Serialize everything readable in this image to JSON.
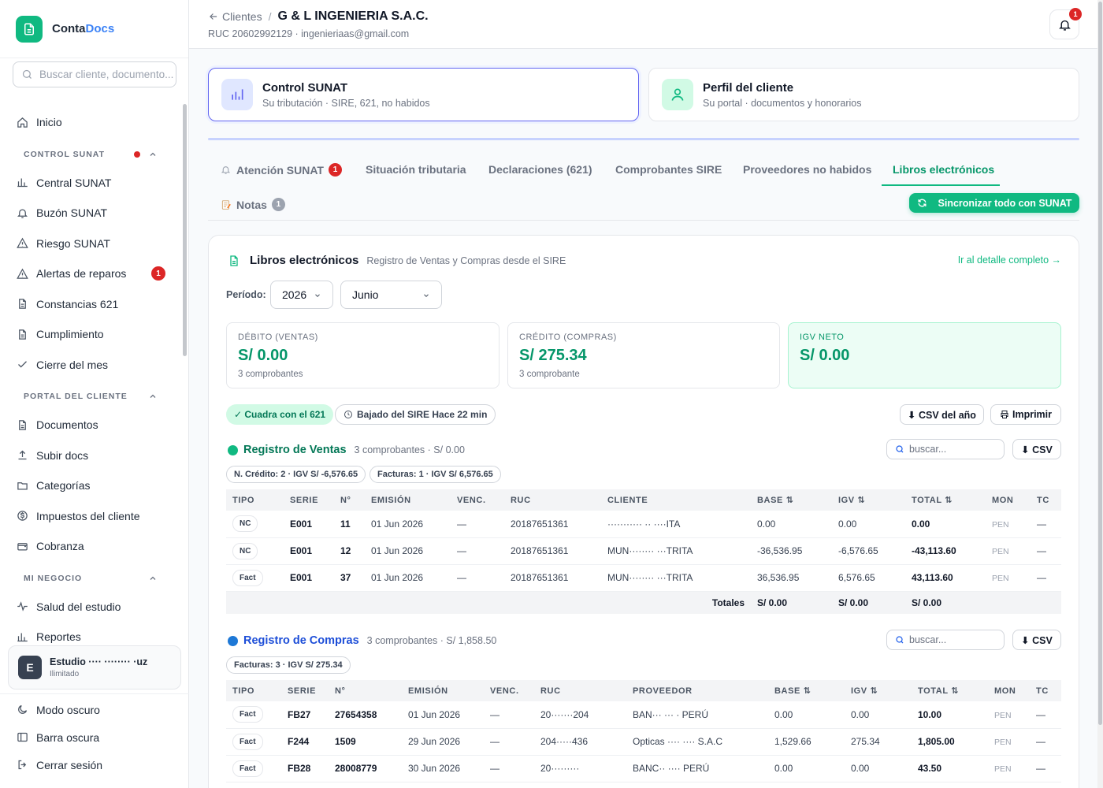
{
  "brand": {
    "name_a": "Conta",
    "name_b": "Docs"
  },
  "search": {
    "placeholder": "Buscar cliente, documento..."
  },
  "nav": {
    "inicio": "Inicio",
    "sec_control": "CONTROL SUNAT",
    "central": "Central SUNAT",
    "buzon": "Buzón SUNAT",
    "riesgo": "Riesgo SUNAT",
    "alertas": "Alertas de reparos",
    "alertas_badge": "1",
    "constancias": "Constancias 621",
    "cumplimiento": "Cumplimiento",
    "cierre": "Cierre del mes",
    "sec_portal": "PORTAL DEL CLIENTE",
    "documentos": "Documentos",
    "subir": "Subir docs",
    "categorias": "Categorías",
    "impuestos": "Impuestos del cliente",
    "cobranza": "Cobranza",
    "sec_negocio": "MI NEGOCIO",
    "salud": "Salud del estudio",
    "reportes": "Reportes"
  },
  "user": {
    "initial": "E",
    "name": "Estudio ···· ········ ·uz",
    "plan": "Ilimitado"
  },
  "bottom": {
    "dark_mode": "Modo oscuro",
    "dark_bar": "Barra oscura",
    "logout": "Cerrar sesión"
  },
  "header": {
    "back": "Clientes",
    "separator": "/",
    "client": "G & L INGENIERIA S.A.C.",
    "ruc_line": "RUC 20602992129 · ingenieriaas@gmail.com",
    "notif_count": "1"
  },
  "modes": [
    {
      "title": "Control SUNAT",
      "sub": "Su tributación · SIRE, 621, no habidos"
    },
    {
      "title": "Perfil del cliente",
      "sub": "Su portal · documentos y honorarios"
    }
  ],
  "tabs": {
    "atencion": "Atención SUNAT",
    "atencion_badge": "1",
    "situacion": "Situación tributaria",
    "declaraciones": "Declaraciones (621)",
    "comprobantes": "Comprobantes SIRE",
    "proveedores": "Proveedores no habidos",
    "libros": "Libros electrónicos",
    "notas": "Notas",
    "notas_badge": "1",
    "sync": "Sincronizar todo con SUNAT"
  },
  "panel": {
    "title": "Libros electrónicos",
    "subtitle": "Registro de Ventas y Compras desde el SIRE",
    "detail_link": "Ir al detalle completo →",
    "period_label": "Período:",
    "year": "2026",
    "month": "Junio"
  },
  "stats": [
    {
      "label": "DÉBITO (VENTAS)",
      "value": "S/ 0.00",
      "sub": "3 comprobantes"
    },
    {
      "label": "CRÉDITO (COMPRAS)",
      "value": "S/ 275.34",
      "sub": "3 comprobante"
    },
    {
      "label": "IGV NETO",
      "value": "S/ 0.00",
      "sub": ""
    }
  ],
  "status": {
    "cuadra": "✓ Cuadra con el 621",
    "bajado": "Bajado del SIRE Hace 22 min",
    "csv_year": "⬇ CSV del año",
    "print": "Imprimir"
  },
  "ventas": {
    "title": "Registro de Ventas",
    "meta": "3 comprobantes · S/ 0.00",
    "search_placeholder": "buscar...",
    "csv": "⬇ CSV",
    "chip1": "N. Crédito: 2 · IGV S/ -6,576.65",
    "chip2": "Facturas: 1 · IGV S/ 6,576.65",
    "headers": [
      "TIPO",
      "SERIE",
      "N°",
      "EMISIÓN",
      "VENC.",
      "RUC",
      "CLIENTE",
      "BASE ⇅",
      "IGV ⇅",
      "TOTAL ⇅",
      "MON",
      "TC"
    ],
    "rows": [
      [
        "NC",
        "E001",
        "11",
        "01 Jun 2026",
        "—",
        "20187651361",
        "··········· ·· ····ITA",
        "0.00",
        "0.00",
        "0.00",
        "PEN",
        "—"
      ],
      [
        "NC",
        "E001",
        "12",
        "01 Jun 2026",
        "—",
        "20187651361",
        "MUN········ ···TRITA",
        "-36,536.95",
        "-6,576.65",
        "-43,113.60",
        "PEN",
        "—"
      ],
      [
        "Fact",
        "E001",
        "37",
        "01 Jun 2026",
        "—",
        "20187651361",
        "MUN········ ···TRITA",
        "36,536.95",
        "6,576.65",
        "43,113.60",
        "PEN",
        "—"
      ]
    ],
    "totals": {
      "label": "Totales",
      "base": "S/ 0.00",
      "igv": "S/ 0.00",
      "total": "S/ 0.00"
    }
  },
  "compras": {
    "title": "Registro de Compras",
    "meta": "3 comprobantes · S/ 1,858.50",
    "search_placeholder": "buscar...",
    "csv": "⬇ CSV",
    "chip1": "Facturas: 3 · IGV S/ 275.34",
    "headers": [
      "TIPO",
      "SERIE",
      "N°",
      "EMISIÓN",
      "VENC.",
      "RUC",
      "PROVEEDOR",
      "BASE ⇅",
      "IGV ⇅",
      "TOTAL ⇅",
      "MON",
      "TC"
    ],
    "rows": [
      [
        "Fact",
        "FB27",
        "27654358",
        "01 Jun 2026",
        "—",
        "20·······204",
        "BAN··· ··· · PERÚ",
        "0.00",
        "0.00",
        "10.00",
        "PEN",
        "—"
      ],
      [
        "Fact",
        "F244",
        "1509",
        "29 Jun 2026",
        "—",
        "204·····436",
        "Opticas ···· ···· S.A.C",
        "1,529.66",
        "275.34",
        "1,805.00",
        "PEN",
        "—"
      ],
      [
        "Fact",
        "FB28",
        "28008779",
        "30 Jun 2026",
        "—",
        "20·········",
        "BANC·· ···· PERÚ",
        "0.00",
        "0.00",
        "43.50",
        "PEN",
        "—"
      ]
    ]
  },
  "colors": {
    "accent": "#10b981",
    "indigo": "#6366f1",
    "danger": "#dc2626",
    "compras_dot": "#1d78d6"
  }
}
